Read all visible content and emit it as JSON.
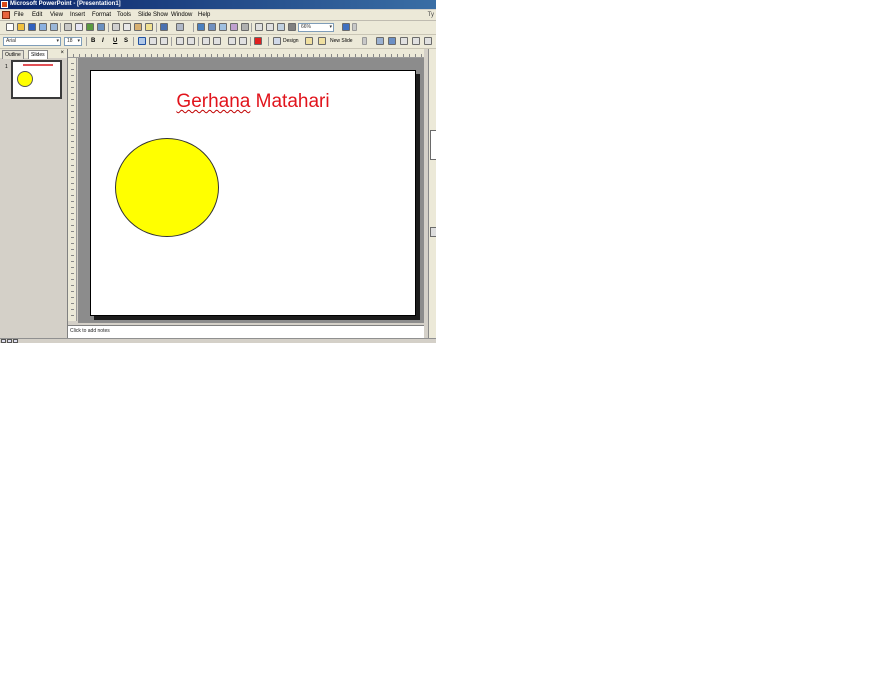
{
  "window": {
    "title": "Microsoft PowerPoint - [Presentation1]"
  },
  "menu": {
    "items": [
      "File",
      "Edit",
      "View",
      "Insert",
      "Format",
      "Tools",
      "Slide Show",
      "Window",
      "Help"
    ],
    "right_hint": "Ty"
  },
  "toolbar": {
    "zoom": "66%",
    "font_name": "Arial",
    "font_size": "18",
    "bold": "B",
    "italic": "I",
    "underline": "U",
    "shadow": "S",
    "design_label": "Design",
    "new_slide_label": "New Slide"
  },
  "left_pane": {
    "tabs": [
      "Outline",
      "Slides"
    ],
    "active_tab": "Slides",
    "close_glyph": "×",
    "slide_number": "1"
  },
  "slide": {
    "title_word1": "Gerhana",
    "title_word2": " Matahari",
    "title_color": "#e1141c",
    "sun_color": "#ffff00"
  },
  "notes": {
    "placeholder": "Click to add notes"
  },
  "icons": {
    "new": "new-doc-icon",
    "open": "open-folder-icon",
    "save": "save-disk-icon",
    "print": "print-icon",
    "undo": "undo-icon",
    "redo": "redo-icon"
  }
}
